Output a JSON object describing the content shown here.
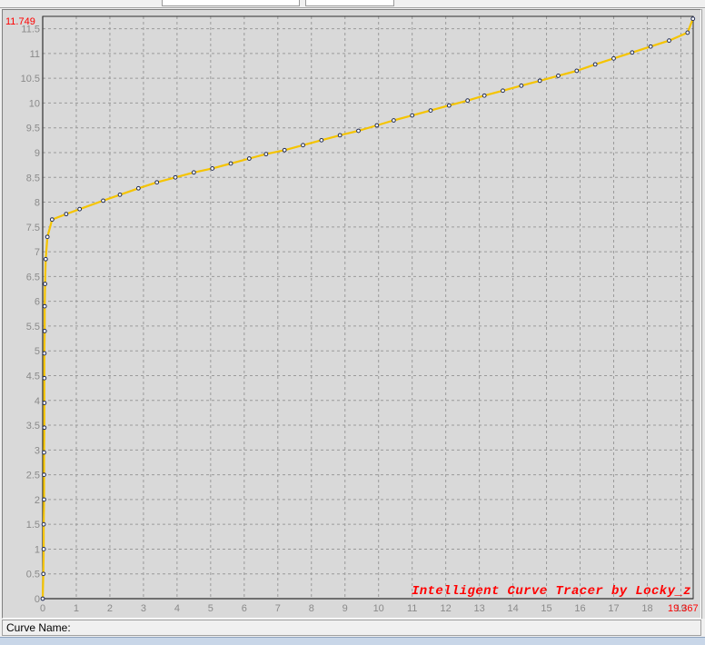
{
  "window": {
    "status_label": "Curve Name:",
    "watermark": "Intelligent Curve Tracer by Locky_z"
  },
  "colors": {
    "plot_background": "#d9d9d9",
    "grid": "#9a9a9a",
    "axis_labels": "#8a8a8a",
    "axis_extremes": "#ff0000",
    "curve": "#f5c400",
    "markers": "#1f2a55",
    "watermark": "#ff0000"
  },
  "chart_data": {
    "type": "line",
    "title": "",
    "xlabel": "",
    "ylabel": "",
    "xlim": [
      0,
      19.367
    ],
    "ylim": [
      0,
      11.749
    ],
    "x_max_label": "19.367",
    "y_max_label": "11.749",
    "x_ticks": [
      "0",
      "1",
      "2",
      "3",
      "4",
      "5",
      "6",
      "7",
      "8",
      "9",
      "10",
      "11",
      "12",
      "13",
      "14",
      "15",
      "16",
      "17",
      "18",
      "19"
    ],
    "y_ticks": [
      "0",
      "0.5",
      "1",
      "1.5",
      "2",
      "2.5",
      "3",
      "3.5",
      "4",
      "4.5",
      "5",
      "5.5",
      "6",
      "6.5",
      "7",
      "7.5",
      "8",
      "8.5",
      "9",
      "9.5",
      "10",
      "10.5",
      "11",
      "11.5"
    ],
    "grid": true,
    "series": [
      {
        "points": [
          [
            0.0,
            0.0
          ],
          [
            0.02,
            0.5
          ],
          [
            0.03,
            1.0
          ],
          [
            0.03,
            1.5
          ],
          [
            0.04,
            2.0
          ],
          [
            0.04,
            2.5
          ],
          [
            0.04,
            2.95
          ],
          [
            0.05,
            3.45
          ],
          [
            0.05,
            3.95
          ],
          [
            0.05,
            4.45
          ],
          [
            0.05,
            4.95
          ],
          [
            0.06,
            5.4
          ],
          [
            0.06,
            5.9
          ],
          [
            0.07,
            6.35
          ],
          [
            0.09,
            6.85
          ],
          [
            0.14,
            7.3
          ],
          [
            0.28,
            7.65
          ],
          [
            0.7,
            7.76
          ],
          [
            1.1,
            7.86
          ],
          [
            1.8,
            8.03
          ],
          [
            2.3,
            8.15
          ],
          [
            2.85,
            8.28
          ],
          [
            3.4,
            8.4
          ],
          [
            3.95,
            8.5
          ],
          [
            4.5,
            8.6
          ],
          [
            5.05,
            8.68
          ],
          [
            5.6,
            8.78
          ],
          [
            6.15,
            8.88
          ],
          [
            6.65,
            8.97
          ],
          [
            7.2,
            9.05
          ],
          [
            7.75,
            9.15
          ],
          [
            8.3,
            9.25
          ],
          [
            8.85,
            9.35
          ],
          [
            9.4,
            9.44
          ],
          [
            9.95,
            9.55
          ],
          [
            10.45,
            9.65
          ],
          [
            11.0,
            9.75
          ],
          [
            11.55,
            9.85
          ],
          [
            12.1,
            9.95
          ],
          [
            12.65,
            10.05
          ],
          [
            13.15,
            10.15
          ],
          [
            13.7,
            10.25
          ],
          [
            14.25,
            10.35
          ],
          [
            14.8,
            10.45
          ],
          [
            15.35,
            10.55
          ],
          [
            15.9,
            10.65
          ],
          [
            16.45,
            10.78
          ],
          [
            17.0,
            10.9
          ],
          [
            17.55,
            11.02
          ],
          [
            18.1,
            11.14
          ],
          [
            18.65,
            11.26
          ],
          [
            19.2,
            11.42
          ],
          [
            19.36,
            11.7
          ]
        ]
      }
    ]
  }
}
